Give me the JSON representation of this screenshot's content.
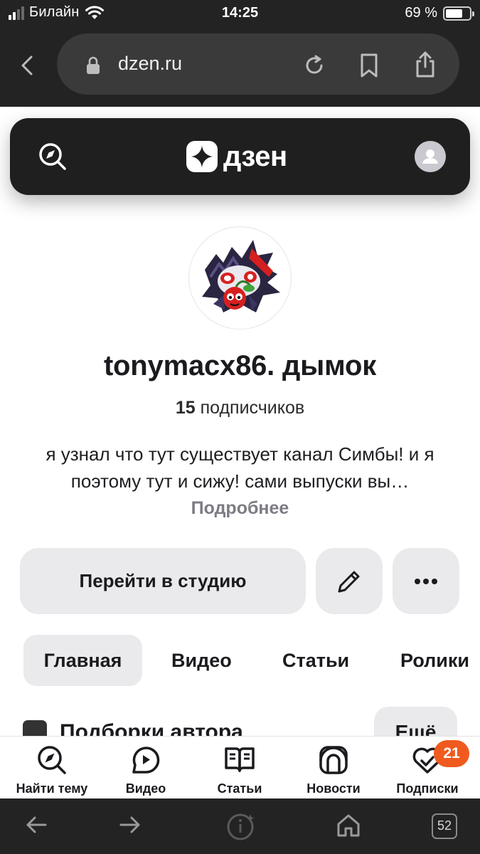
{
  "status_bar": {
    "carrier": "Билайн",
    "time": "14:25",
    "battery": "69 %"
  },
  "browser": {
    "url": "dzen.ru",
    "open_tabs": "52"
  },
  "dzen_header": {
    "logo_text": "дзен"
  },
  "channel": {
    "name": "tonymacx86. дымок",
    "subscribers_count": "15",
    "subscribers_label": "подписчиков",
    "description": "я узнал что тут существует канал Симбы! и я поэтому тут и сижу! сами выпуски вы…",
    "more_link": "Подробнее"
  },
  "actions": {
    "studio_label": "Перейти в студию"
  },
  "tabs": [
    "Главная",
    "Видео",
    "Статьи",
    "Ролики"
  ],
  "section": {
    "title": "Подборки автора",
    "more_label": "Ещё"
  },
  "bottom_nav": {
    "items": [
      "Найти тему",
      "Видео",
      "Статьи",
      "Новости",
      "Подписки"
    ],
    "subscriptions_badge": "21"
  },
  "colors": {
    "dark_chrome": "#232323",
    "dzen_header": "#1f1f1f",
    "button_bg": "#eaeaed",
    "badge": "#f05a1e",
    "muted_text": "#7c7c84"
  }
}
